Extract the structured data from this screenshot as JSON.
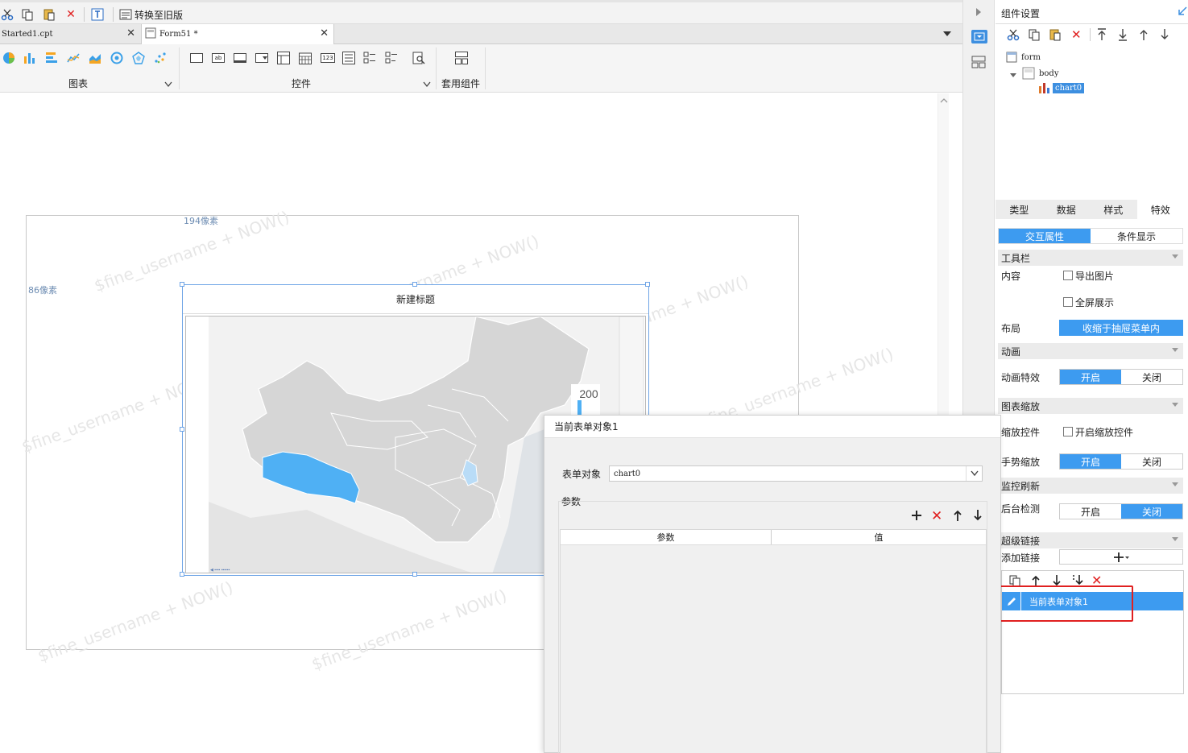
{
  "toolbar": {
    "convert_label": "转换至旧版"
  },
  "tabs": [
    {
      "label": "Started1.cpt"
    },
    {
      "label": "Form51 *"
    }
  ],
  "ribbon": {
    "charts_label": "图表",
    "controls_label": "控件",
    "templates_label": "套用组件"
  },
  "canvas": {
    "width_label": "194像素",
    "height_label": "86像素",
    "watermark": "$fine_username + NOW()"
  },
  "chart": {
    "title": "新建标题",
    "legend_max": "200",
    "highlight_color": "#4fb0f4",
    "chart_data": {
      "type": "map",
      "region": "China",
      "highlighted_regions": [
        "Tibet"
      ],
      "legend_values": [
        "200"
      ]
    }
  },
  "right_panel": {
    "title": "组件设置",
    "tree": {
      "root": "form",
      "body": "body",
      "chart": "chart0"
    },
    "tabs": [
      "类型",
      "数据",
      "样式",
      "特效"
    ],
    "subtabs": [
      "交互属性",
      "条件显示"
    ],
    "toolbar_section": "工具栏",
    "content_label": "内容",
    "export_image": "导出图片",
    "fullscreen": "全屏展示",
    "layout_label": "布局",
    "layout_value": "收缩于抽屉菜单内",
    "animation_section": "动画",
    "animation_effect": "动画特效",
    "zoom_section": "图表缩放",
    "zoom_control": "缩放控件",
    "zoom_control_check": "开启缩放控件",
    "gesture_zoom": "手势缩放",
    "monitor_section": "监控刷新",
    "backend_check": "后台检测",
    "hyperlink_section": "超级链接",
    "add_link": "添加链接",
    "on": "开启",
    "off": "关闭",
    "link_item": "当前表单对象1"
  },
  "dialog": {
    "title": "当前表单对象1",
    "form_object_label": "表单对象",
    "form_object_value": "chart0",
    "params_label": "参数",
    "col_param": "参数",
    "col_value": "值"
  }
}
